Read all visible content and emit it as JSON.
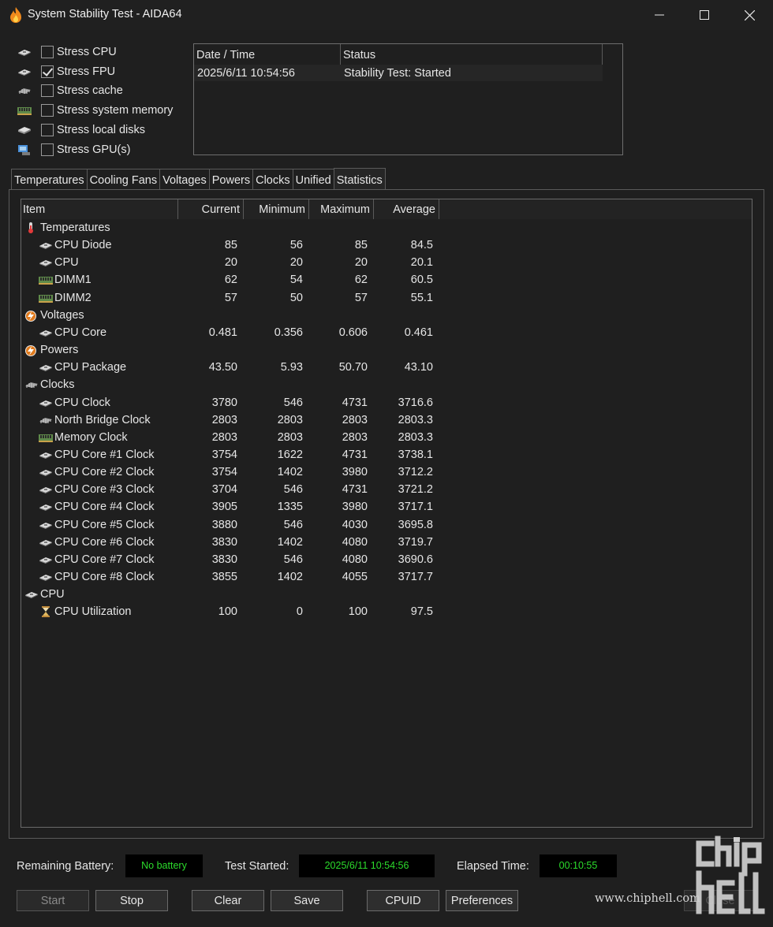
{
  "window": {
    "title": "System Stability Test - AIDA64",
    "controls": {
      "minimize": "—",
      "maximize": "☐",
      "close": "✕"
    }
  },
  "stress_options": [
    {
      "label": "Stress CPU",
      "checked": false,
      "icon": "cpu-chip-icon"
    },
    {
      "label": "Stress FPU",
      "checked": true,
      "icon": "fpu-chip-icon"
    },
    {
      "label": "Stress cache",
      "checked": false,
      "icon": "cache-chip-icon"
    },
    {
      "label": "Stress system memory",
      "checked": false,
      "icon": "memory-module-icon"
    },
    {
      "label": "Stress local disks",
      "checked": false,
      "icon": "disk-icon"
    },
    {
      "label": "Stress GPU(s)",
      "checked": false,
      "icon": "gpu-icon"
    }
  ],
  "log": {
    "headers": [
      "Date / Time",
      "Status"
    ],
    "rows": [
      {
        "datetime": "2025/6/11 10:54:56",
        "status": "Stability Test: Started"
      }
    ]
  },
  "tabs": [
    "Temperatures",
    "Cooling Fans",
    "Voltages",
    "Powers",
    "Clocks",
    "Unified",
    "Statistics"
  ],
  "active_tab": "Statistics",
  "stats": {
    "headers": {
      "item": "Item",
      "current": "Current",
      "minimum": "Minimum",
      "maximum": "Maximum",
      "average": "Average"
    },
    "rows": [
      {
        "group": true,
        "label": "Temperatures",
        "icon": "thermometer-icon"
      },
      {
        "label": "CPU Diode",
        "icon": "cpu-chip-icon",
        "current": "85",
        "minimum": "56",
        "maximum": "85",
        "average": "84.5"
      },
      {
        "label": "CPU",
        "icon": "cpu-chip-icon",
        "current": "20",
        "minimum": "20",
        "maximum": "20",
        "average": "20.1"
      },
      {
        "label": "DIMM1",
        "icon": "memory-module-icon",
        "current": "62",
        "minimum": "54",
        "maximum": "62",
        "average": "60.5"
      },
      {
        "label": "DIMM2",
        "icon": "memory-module-icon",
        "current": "57",
        "minimum": "50",
        "maximum": "57",
        "average": "55.1"
      },
      {
        "group": true,
        "label": "Voltages",
        "icon": "lightning-icon"
      },
      {
        "label": "CPU Core",
        "icon": "cpu-chip-icon",
        "current": "0.481",
        "minimum": "0.356",
        "maximum": "0.606",
        "average": "0.461"
      },
      {
        "group": true,
        "label": "Powers",
        "icon": "lightning-icon"
      },
      {
        "label": "CPU Package",
        "icon": "cpu-chip-icon",
        "current": "43.50",
        "minimum": "5.93",
        "maximum": "50.70",
        "average": "43.10"
      },
      {
        "group": true,
        "label": "Clocks",
        "icon": "clock-chip-icon"
      },
      {
        "label": "CPU Clock",
        "icon": "cpu-chip-icon",
        "current": "3780",
        "minimum": "546",
        "maximum": "4731",
        "average": "3716.6"
      },
      {
        "label": "North Bridge Clock",
        "icon": "cache-chip-icon",
        "current": "2803",
        "minimum": "2803",
        "maximum": "2803",
        "average": "2803.3"
      },
      {
        "label": "Memory Clock",
        "icon": "memory-module-icon",
        "current": "2803",
        "minimum": "2803",
        "maximum": "2803",
        "average": "2803.3"
      },
      {
        "label": "CPU Core #1 Clock",
        "icon": "cpu-chip-icon",
        "current": "3754",
        "minimum": "1622",
        "maximum": "4731",
        "average": "3738.1"
      },
      {
        "label": "CPU Core #2 Clock",
        "icon": "cpu-chip-icon",
        "current": "3754",
        "minimum": "1402",
        "maximum": "3980",
        "average": "3712.2"
      },
      {
        "label": "CPU Core #3 Clock",
        "icon": "cpu-chip-icon",
        "current": "3704",
        "minimum": "546",
        "maximum": "4731",
        "average": "3721.2"
      },
      {
        "label": "CPU Core #4 Clock",
        "icon": "cpu-chip-icon",
        "current": "3905",
        "minimum": "1335",
        "maximum": "3980",
        "average": "3717.1"
      },
      {
        "label": "CPU Core #5 Clock",
        "icon": "cpu-chip-icon",
        "current": "3880",
        "minimum": "546",
        "maximum": "4030",
        "average": "3695.8"
      },
      {
        "label": "CPU Core #6 Clock",
        "icon": "cpu-chip-icon",
        "current": "3830",
        "minimum": "1402",
        "maximum": "4080",
        "average": "3719.7"
      },
      {
        "label": "CPU Core #7 Clock",
        "icon": "cpu-chip-icon",
        "current": "3830",
        "minimum": "546",
        "maximum": "4080",
        "average": "3690.6"
      },
      {
        "label": "CPU Core #8 Clock",
        "icon": "cpu-chip-icon",
        "current": "3855",
        "minimum": "1402",
        "maximum": "4055",
        "average": "3717.7"
      },
      {
        "group": true,
        "label": "CPU",
        "icon": "cpu-chip-icon"
      },
      {
        "label": "CPU Utilization",
        "icon": "hourglass-icon",
        "current": "100",
        "minimum": "0",
        "maximum": "100",
        "average": "97.5"
      }
    ]
  },
  "status_bar": {
    "battery_label": "Remaining Battery:",
    "battery_value": "No battery",
    "started_label": "Test Started:",
    "started_value": "2025/6/11 10:54:56",
    "elapsed_label": "Elapsed Time:",
    "elapsed_value": "00:10:55"
  },
  "buttons": {
    "start": "Start",
    "stop": "Stop",
    "clear": "Clear",
    "save": "Save",
    "cpuid": "CPUID",
    "preferences": "Preferences",
    "close": "Close"
  },
  "watermark": {
    "url": "www.chiphell.com",
    "logo_text": "chip hell"
  },
  "colors": {
    "background": "#1f1f1f",
    "lcd_text": "#2cdc2c",
    "lcd_bg": "#000000"
  }
}
